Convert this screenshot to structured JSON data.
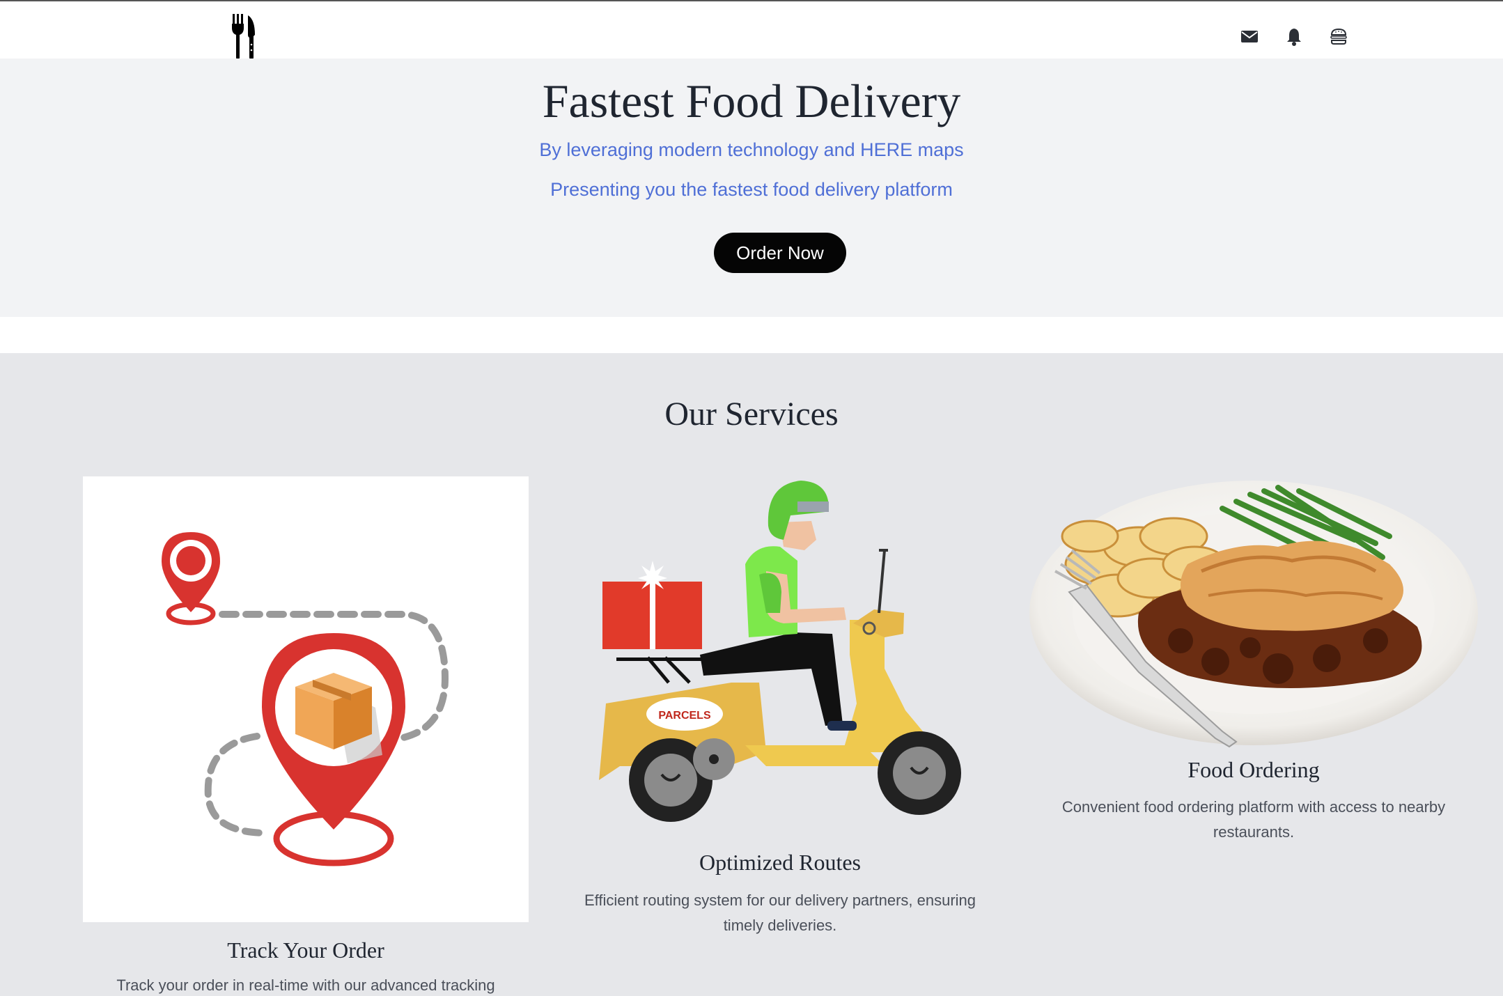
{
  "nav": {
    "logo_icon": "fork-knife-icon",
    "icons": [
      "envelope-icon",
      "bell-icon",
      "burger-icon"
    ],
    "icon_color": "#2b2f36"
  },
  "hero": {
    "title": "Fastest Food Delivery",
    "subtitle_1": "By leveraging modern technology and HERE maps",
    "subtitle_2": "Presenting you the fastest food delivery platform",
    "cta_label": "Order Now",
    "accent_color": "#4f6fd6",
    "background": "#f2f3f5"
  },
  "services": {
    "heading": "Our Services",
    "background": "#e6e7ea",
    "cards": [
      {
        "title": "Track Your Order",
        "description": "Track your order in real-time with our advanced tracking",
        "image_icon": "map-pin-package-icon"
      },
      {
        "title": "Optimized Routes",
        "description": "Efficient routing system for our delivery partners, ensuring timely deliveries.",
        "image_icon": "delivery-scooter-icon"
      },
      {
        "title": "Food Ordering",
        "description": "Convenient food ordering platform with access to nearby restaurants.",
        "image_icon": "food-plate-icon"
      }
    ]
  },
  "scooter_box_label": "PARCELS"
}
